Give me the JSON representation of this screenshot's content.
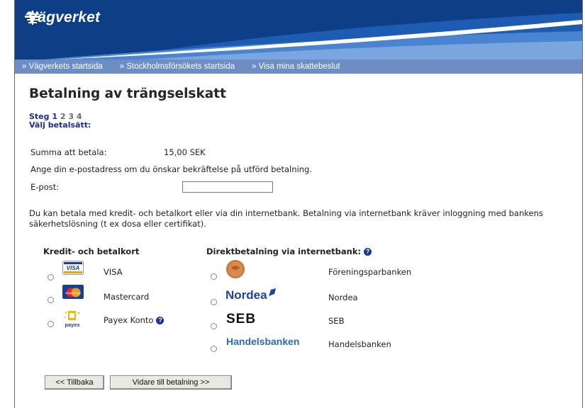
{
  "header": {
    "logo_text": "Vägverket"
  },
  "nav": {
    "items": [
      "» Vägverkets startsida",
      "» Stockholmsförsökets startsida",
      "» Visa mina skattebeslut"
    ]
  },
  "page": {
    "title": "Betalning av trängselskatt",
    "steps_label": "Steg",
    "steps_done": "1",
    "steps_current": "2",
    "steps_rest": "3 4",
    "step_heading": "Välj betalsätt:",
    "amount_label": "Summa att betala:",
    "amount_value": "15,00 SEK",
    "email_prompt": "Ange din e-postadress om du önskar bekräftelse på utförd betalning.",
    "email_label": "E-post:",
    "email_value": "",
    "info_text": "Du kan betala med kredit- och betalkort eller via din internetbank. Betalning via internetbank kräver inloggning med bankens säkerhetslösning (t ex dosa eller certifikat)."
  },
  "cards": {
    "heading": "Kredit- och betalkort",
    "options": [
      {
        "label": "VISA",
        "icon": "visa-card-icon"
      },
      {
        "label": "Mastercard",
        "icon": "mastercard-icon"
      },
      {
        "label": "Payex Konto",
        "icon": "payex-icon"
      }
    ]
  },
  "banks": {
    "heading": "Direktbetalning via internetbank:",
    "options": [
      {
        "label": "Föreningsparbanken",
        "logo_text": ""
      },
      {
        "label": "Nordea",
        "logo_text": "Nordea"
      },
      {
        "label": "SEB",
        "logo_text": "SEB"
      },
      {
        "label": "Handelsbanken",
        "logo_text": "Handelsbanken"
      }
    ]
  },
  "buttons": {
    "back": "<< Tillbaka",
    "next": "Vidare till betalning >>"
  },
  "colors": {
    "banner": "#0e3e86",
    "nav": "#6d8dc5",
    "step_link": "#1a2f8a",
    "help_icon": "#1d2f9c"
  }
}
